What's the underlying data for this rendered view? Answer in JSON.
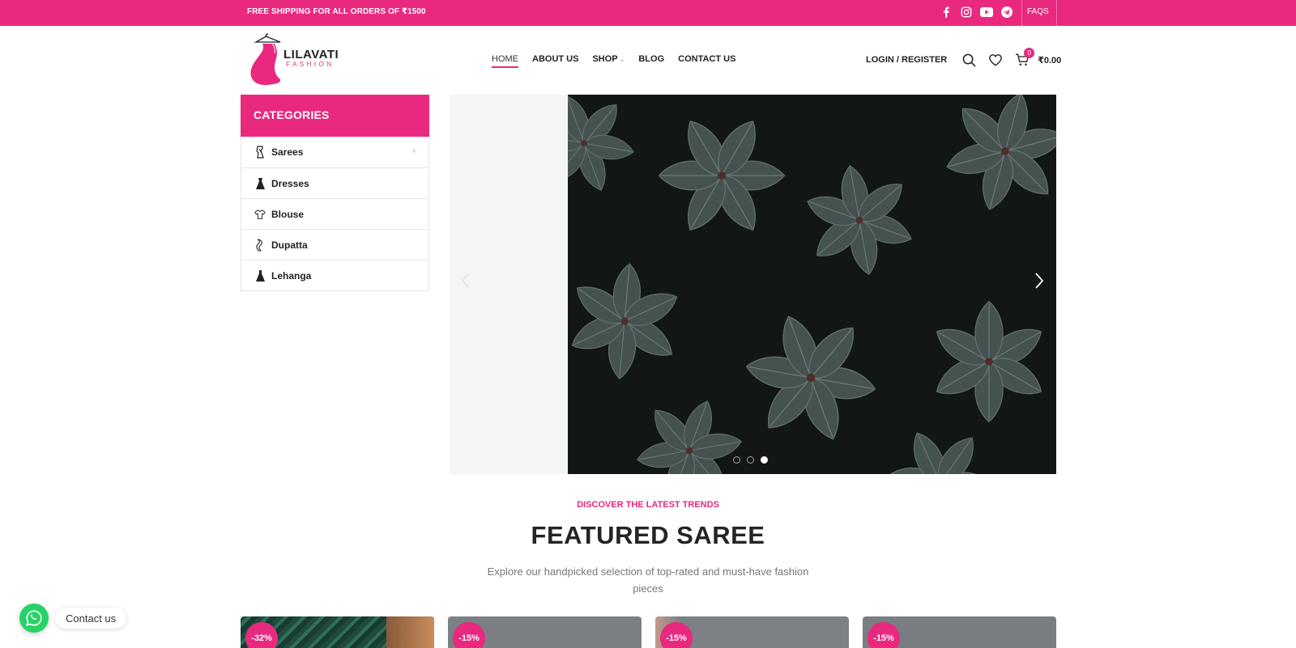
{
  "topbar": {
    "shipping_text": "FREE SHIPPING FOR ALL ORDERS OF ₹1500",
    "social_icons": [
      "facebook-icon",
      "instagram-icon",
      "youtube-icon",
      "telegram-icon"
    ],
    "faqs_label": "FAQS",
    "background": "#e9297e"
  },
  "logo": {
    "brand": "LILAVATI",
    "sub": "FASHION"
  },
  "nav": {
    "items": [
      {
        "label": "HOME",
        "active": true
      },
      {
        "label": "ABOUT US"
      },
      {
        "label": "SHOP",
        "has_dropdown": true
      },
      {
        "label": "BLOG"
      },
      {
        "label": "CONTACT US"
      }
    ]
  },
  "header_actions": {
    "login_label": "LOGIN / REGISTER",
    "cart_count": "0",
    "cart_total": "₹0.00"
  },
  "categories": {
    "title": "CATEGORIES",
    "items": [
      {
        "label": "Sarees",
        "icon": "saree-icon"
      },
      {
        "label": "Dresses",
        "icon": "dress-icon"
      },
      {
        "label": "Blouse",
        "icon": "blouse-icon"
      },
      {
        "label": "Dupatta",
        "icon": "dupatta-icon"
      },
      {
        "label": "Lehanga",
        "icon": "lehanga-icon"
      }
    ]
  },
  "slider": {
    "slide_count": 3,
    "active_slide": 3
  },
  "featured": {
    "kicker": "DISCOVER THE LATEST TRENDS",
    "title": "FEATURED SAREE",
    "description": "Explore our handpicked selection of top-rated and must-have fashion pieces",
    "products": [
      {
        "discount": "-32%"
      },
      {
        "discount": "-15%"
      },
      {
        "discount": "-15%"
      },
      {
        "discount": "-15%"
      }
    ]
  },
  "whatsapp": {
    "label": "Contact us"
  },
  "colors": {
    "accent": "#e9297e",
    "whatsapp": "#25d366"
  }
}
